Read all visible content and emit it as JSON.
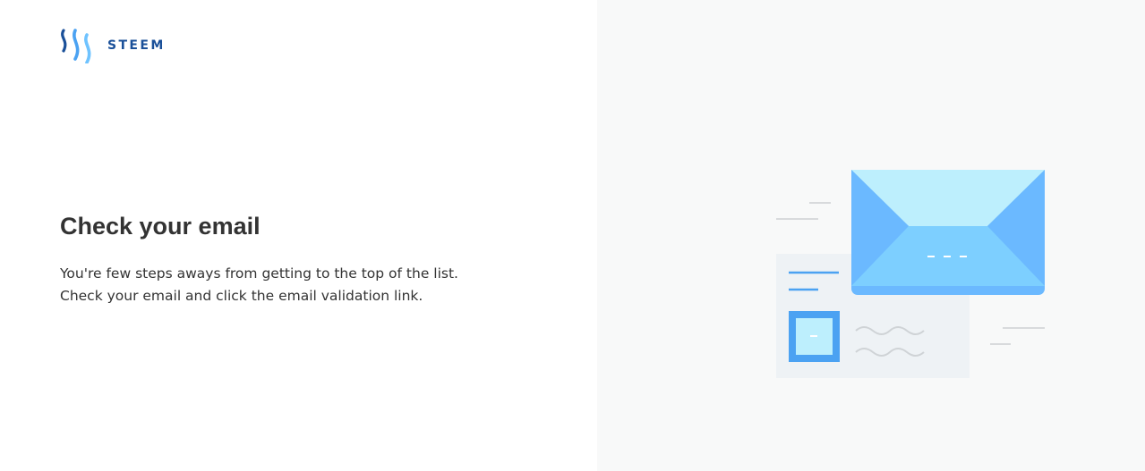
{
  "brand": {
    "name": "STEEM",
    "logo_icon": "steem-logo-icon",
    "colors": {
      "text": "#1a5099",
      "dark": "#1a5099",
      "mid": "#4ba2f2",
      "light": "#6fc3ff"
    }
  },
  "main": {
    "title": "Check your email",
    "description_line1": "You're few steps aways from getting to the top of the list.",
    "description_line2": "Check your email and click the email validation link."
  },
  "illustration": {
    "icon": "envelope-illustration-icon",
    "colors": {
      "envelope_back": "#bdeffd",
      "envelope_side": "#6bb9ff",
      "envelope_front": "#7dcfff",
      "card": "#eef2f5",
      "accent": "#4ba2f2",
      "line": "#d8dadc"
    }
  }
}
